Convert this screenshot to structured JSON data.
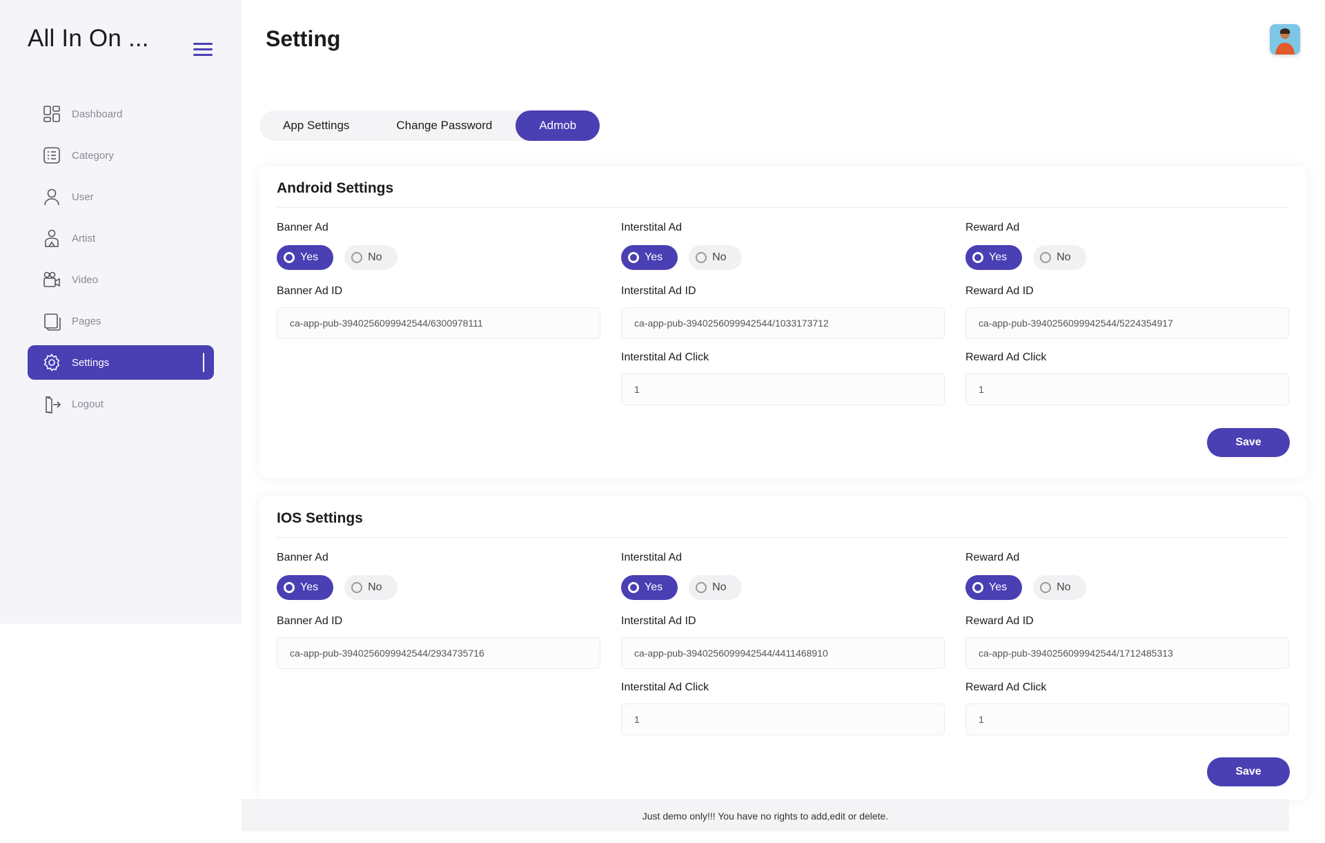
{
  "app": {
    "brand": "All In On ...",
    "page_title": "Setting"
  },
  "sidebar": {
    "items": [
      {
        "label": "Dashboard",
        "icon": "dashboard-icon"
      },
      {
        "label": "Category",
        "icon": "list-icon"
      },
      {
        "label": "User",
        "icon": "user-icon"
      },
      {
        "label": "Artist",
        "icon": "artist-icon"
      },
      {
        "label": "Video",
        "icon": "video-icon"
      },
      {
        "label": "Pages",
        "icon": "pages-icon"
      },
      {
        "label": "Settings",
        "icon": "gear-icon",
        "active": true
      },
      {
        "label": "Logout",
        "icon": "logout-icon"
      }
    ]
  },
  "tabs": [
    {
      "label": "App Settings"
    },
    {
      "label": "Change Password"
    },
    {
      "label": "Admob",
      "active": true
    }
  ],
  "android": {
    "title": "Android Settings",
    "banner": {
      "label": "Banner Ad",
      "yes": "Yes",
      "no": "No",
      "selected": "Yes",
      "id_label": "Banner Ad ID",
      "id_value": "ca-app-pub-3940256099942544/6300978111"
    },
    "interstitial": {
      "label": "Interstital Ad",
      "yes": "Yes",
      "no": "No",
      "selected": "Yes",
      "id_label": "Interstital Ad ID",
      "id_value": "ca-app-pub-3940256099942544/1033173712",
      "click_label": "Interstital Ad Click",
      "click_value": "1"
    },
    "reward": {
      "label": "Reward Ad",
      "yes": "Yes",
      "no": "No",
      "selected": "Yes",
      "id_label": "Reward Ad ID",
      "id_value": "ca-app-pub-3940256099942544/5224354917",
      "click_label": "Reward Ad Click",
      "click_value": "1"
    },
    "save_label": "Save"
  },
  "ios": {
    "title": "IOS Settings",
    "banner": {
      "label": "Banner Ad",
      "yes": "Yes",
      "no": "No",
      "selected": "Yes",
      "id_label": "Banner Ad ID",
      "id_value": "ca-app-pub-3940256099942544/2934735716"
    },
    "interstitial": {
      "label": "Interstital Ad",
      "yes": "Yes",
      "no": "No",
      "selected": "Yes",
      "id_label": "Interstital Ad ID",
      "id_value": "ca-app-pub-3940256099942544/4411468910",
      "click_label": "Interstital Ad Click",
      "click_value": "1"
    },
    "reward": {
      "label": "Reward Ad",
      "yes": "Yes",
      "no": "No",
      "selected": "Yes",
      "id_label": "Reward Ad ID",
      "id_value": "ca-app-pub-3940256099942544/1712485313",
      "click_label": "Reward Ad Click",
      "click_value": "1"
    },
    "save_label": "Save"
  },
  "footer": {
    "notice": "Just demo only!!! You have no rights to add,edit or delete."
  },
  "colors": {
    "accent": "#4a3fb3",
    "sidebar_bg": "#f4f4f9"
  }
}
